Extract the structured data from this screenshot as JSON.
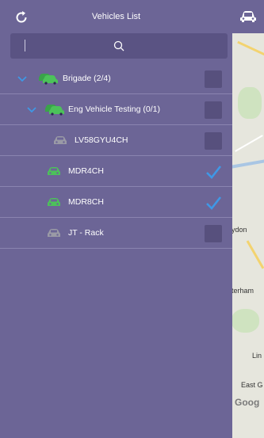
{
  "header": {
    "title": "Vehicles List",
    "refresh_icon": "refresh-icon",
    "map_toggle_icon": "car-icon"
  },
  "search": {
    "placeholder": ""
  },
  "colors": {
    "panel": "#6c6596",
    "green": "#4cc25a",
    "check": "#3f98e6",
    "grey": "#9a9aa6"
  },
  "tree": [
    {
      "label": "Brigade   (2/4)",
      "level": 0,
      "type": "group",
      "checked": false
    },
    {
      "label": "Eng Vehicle Testing   (0/1)",
      "level": 1,
      "type": "group",
      "checked": false
    },
    {
      "label": "LV58GYU4CH",
      "level": 2,
      "type": "vehicle",
      "status": "offline",
      "checked": false
    },
    {
      "label": "MDR4CH",
      "level": 1,
      "type": "vehicle",
      "status": "online",
      "checked": true
    },
    {
      "label": "MDR8CH",
      "level": 1,
      "type": "vehicle",
      "status": "online",
      "checked": true
    },
    {
      "label": "JT - Rack",
      "level": 1,
      "type": "vehicle",
      "status": "offline",
      "checked": false
    }
  ],
  "map": {
    "labels": [
      "ydon",
      "terham",
      "Lin",
      "East G"
    ],
    "logo": "Goog"
  }
}
